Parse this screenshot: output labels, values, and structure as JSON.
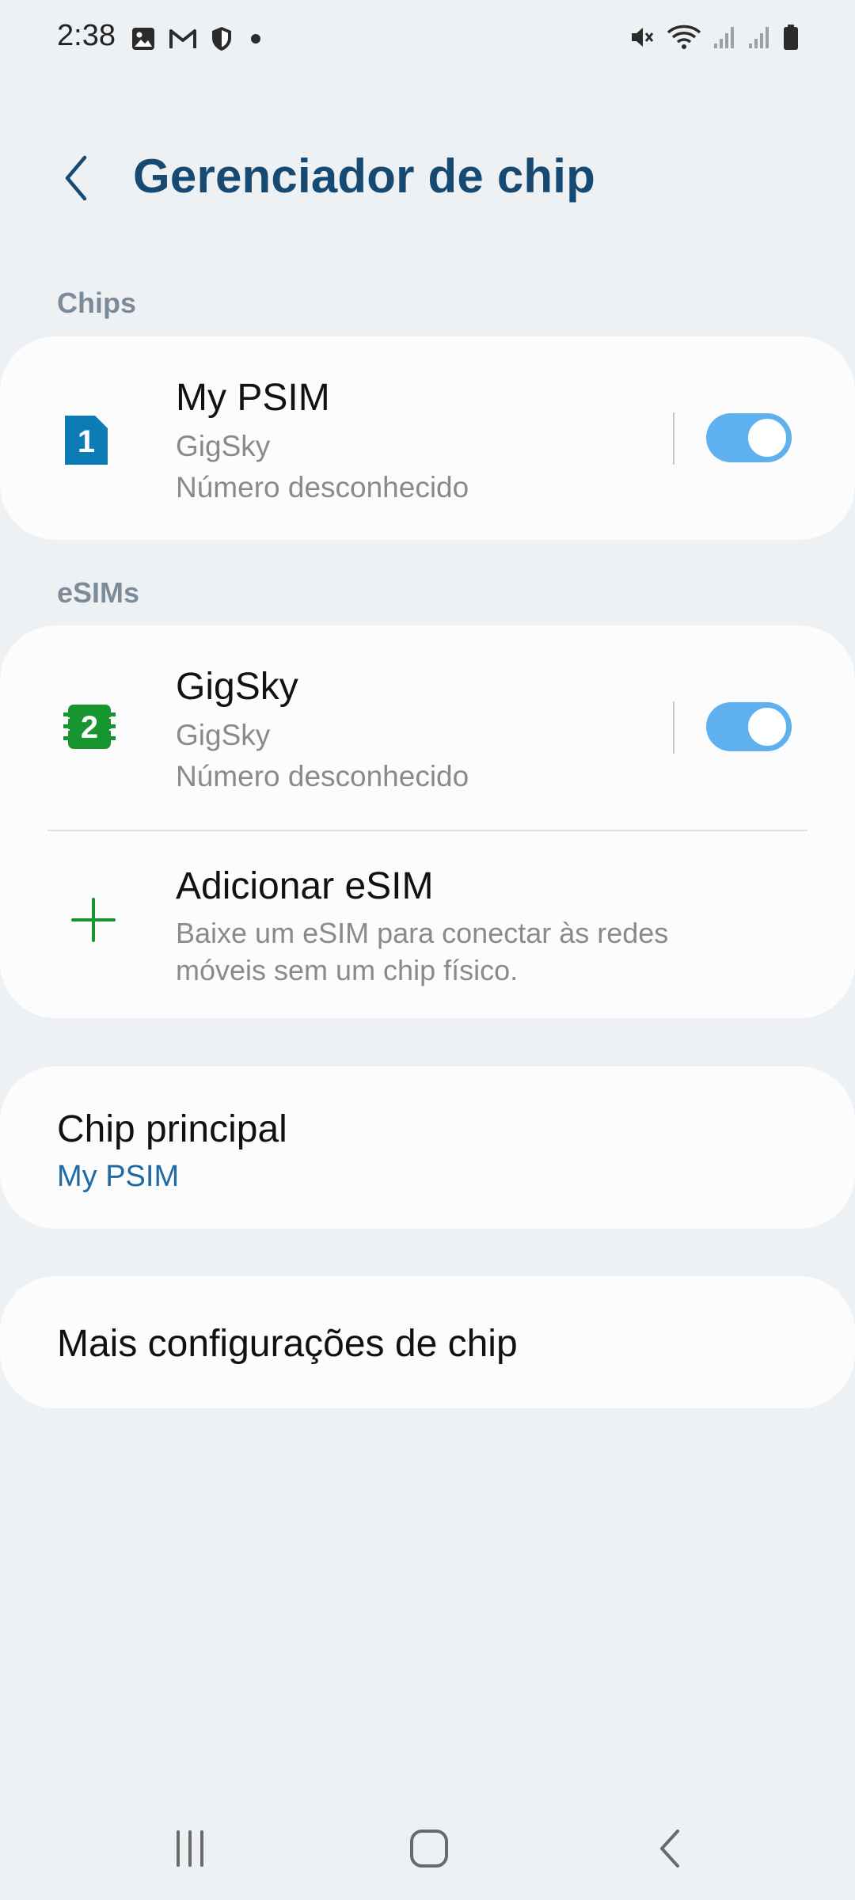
{
  "status_bar": {
    "time": "2:38",
    "left_icons": [
      "gallery-icon",
      "gmail-icon",
      "shield-icon",
      "dot-icon"
    ],
    "right_icons": [
      "mute-icon",
      "wifi-icon",
      "signal-icon",
      "signal-icon",
      "battery-icon"
    ]
  },
  "header": {
    "title": "Gerenciador de chip"
  },
  "chips_section": {
    "header": "Chips",
    "items": [
      {
        "name": "My PSIM",
        "carrier": "GigSky",
        "number": "Número desconhecido",
        "slot": "1",
        "enabled": true,
        "icon": "sim-card-icon",
        "color": "#0c7bb6"
      }
    ]
  },
  "esims_section": {
    "header": "eSIMs",
    "items": [
      {
        "name": "GigSky",
        "carrier": "GigSky",
        "number": "Número desconhecido",
        "slot": "2",
        "enabled": true,
        "icon": "esim-chip-icon",
        "color": "#17962f"
      }
    ],
    "add": {
      "title": "Adicionar eSIM",
      "subtitle_line1": "Baixe um eSIM para conectar às redes",
      "subtitle_line2": "móveis sem um chip físico."
    }
  },
  "primary_chip": {
    "title": "Chip principal",
    "value": "My PSIM"
  },
  "more_settings": {
    "title": "Mais configurações de chip"
  },
  "nav_bar": {
    "buttons": [
      "recents-icon",
      "home-icon",
      "back-icon"
    ]
  },
  "colors": {
    "background": "#eef1f4",
    "card": "#fcfcfc",
    "title": "#164a72",
    "accent_blue": "#1e6aa6",
    "toggle_on": "#5fb0ee",
    "add_icon": "#17962f"
  }
}
